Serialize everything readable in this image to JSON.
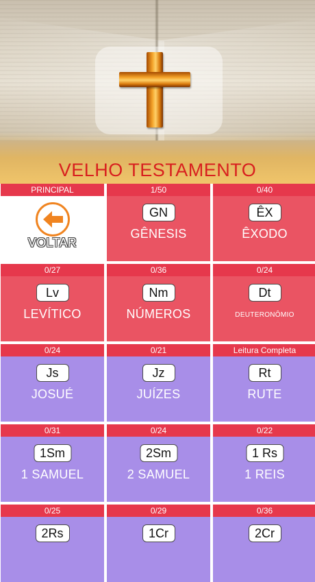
{
  "header": {
    "title": "VELHO TESTAMENTO",
    "icon": "cross-icon"
  },
  "colors": {
    "title_red": "#d8201f",
    "strip_red": "#e6384c",
    "card_pink": "#ea5463",
    "card_purple": "#a88ee8",
    "back_orange": "#f08420"
  },
  "back": {
    "label": "PRINCIPAL",
    "button": "VOLTAR",
    "icon": "arrow-left-icon"
  },
  "books": [
    {
      "progress": "1/50",
      "abbr": "GN",
      "name": "GÊNESIS"
    },
    {
      "progress": "0/40",
      "abbr": "ÊX",
      "name": "ÊXODO"
    },
    {
      "progress": "0/27",
      "abbr": "Lv",
      "name": "LEVÍTICO"
    },
    {
      "progress": "0/36",
      "abbr": "Nm",
      "name": "NÚMEROS"
    },
    {
      "progress": "0/24",
      "abbr": "Dt",
      "name": "DEUTERONÔMIO"
    },
    {
      "progress": "0/24",
      "abbr": "Js",
      "name": "JOSUÉ"
    },
    {
      "progress": "0/21",
      "abbr": "Jz",
      "name": "JUÍZES"
    },
    {
      "progress": "Leitura Completa",
      "abbr": "Rt",
      "name": "RUTE"
    },
    {
      "progress": "0/31",
      "abbr": "1Sm",
      "name": "1 SAMUEL"
    },
    {
      "progress": "0/24",
      "abbr": "2Sm",
      "name": "2 SAMUEL"
    },
    {
      "progress": "0/22",
      "abbr": "1 Rs",
      "name": "1 REIS"
    },
    {
      "progress": "0/25",
      "abbr": "2Rs",
      "name": ""
    },
    {
      "progress": "0/29",
      "abbr": "1Cr",
      "name": ""
    },
    {
      "progress": "0/36",
      "abbr": "2Cr",
      "name": ""
    }
  ]
}
